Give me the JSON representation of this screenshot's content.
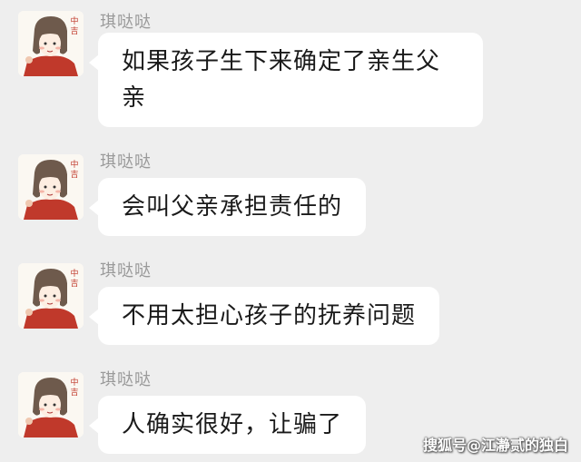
{
  "messages": [
    {
      "sender": "琪哒哒",
      "text": "如果孩子生下来确定了亲生父亲",
      "avatar_icon": "cartoon-girl-avatar"
    },
    {
      "sender": "琪哒哒",
      "text": "会叫父亲承担责任的",
      "avatar_icon": "cartoon-girl-avatar"
    },
    {
      "sender": "琪哒哒",
      "text": "不用太担心孩子的抚养问题",
      "avatar_icon": "cartoon-girl-avatar"
    },
    {
      "sender": "琪哒哒",
      "text": "人确实很好，让骗了",
      "avatar_icon": "cartoon-girl-avatar"
    }
  ],
  "avatar_badge": "中吉",
  "watermark": "搜狐号@江瀞贰的独白",
  "colors": {
    "background": "#eeeeee",
    "bubble": "#ffffff",
    "sender": "#9a9a9a",
    "text": "#1a1a1a",
    "hair": "#6e5a4c",
    "dress": "#c0392b"
  }
}
